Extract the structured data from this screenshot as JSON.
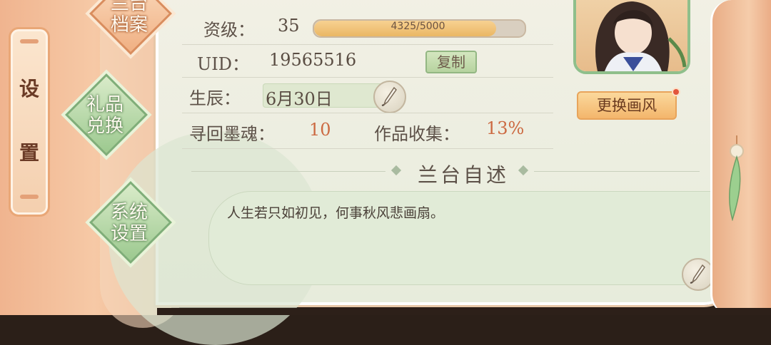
{
  "sidebar": {
    "setting_tab": {
      "char1": "设",
      "char2": "置"
    },
    "buttons": [
      {
        "line1": "兰台",
        "line2": "档案"
      },
      {
        "line1": "礼品",
        "line2": "兑换"
      },
      {
        "line1": "系统",
        "line2": "设置"
      }
    ]
  },
  "profile": {
    "level_label": "资级：",
    "level_value": "35",
    "exp_text": "4325/5000",
    "exp_progress": 0.865,
    "uid_label": "UID：",
    "uid_value": "19565516",
    "copy_label": "复制",
    "birthday_label": "生辰：",
    "birthday_value": "6月30日",
    "ink_soul_label": "寻回墨魂：",
    "ink_soul_value": "10",
    "collection_label": "作品收集：",
    "collection_value": "13%"
  },
  "avatar": {
    "change_style_label": "更换画风"
  },
  "self_intro": {
    "title": "兰台自述",
    "text": "人生若只如初见，何事秋风悲画扇。"
  },
  "icons": [
    "brush-pen-icon",
    "notification-dot-icon",
    "jade-pendant-icon"
  ],
  "colors": {
    "accent_orange": "#f0b48f",
    "accent_green": "#9cc98f",
    "value_red": "#cc6a42",
    "exp_fill": "#eab764"
  }
}
